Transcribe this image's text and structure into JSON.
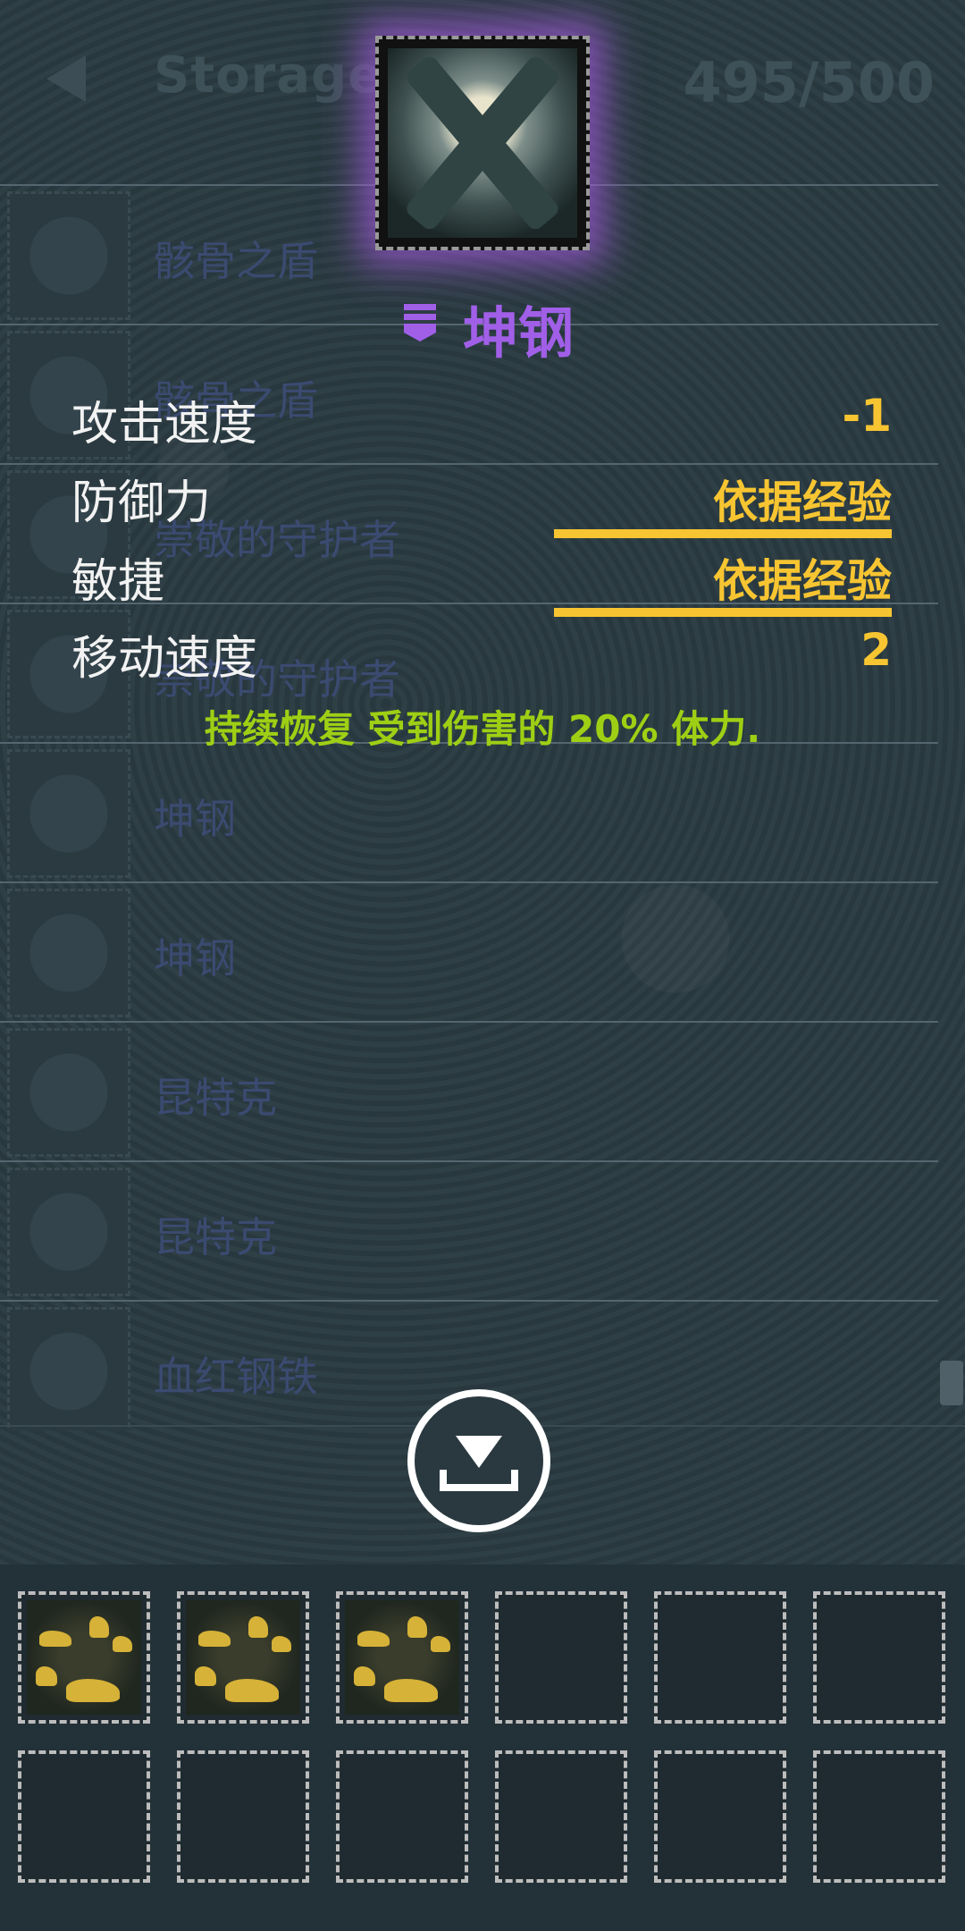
{
  "header": {
    "title": "Storage",
    "count": "495/500"
  },
  "storage_list": [
    {
      "name": "骸骨之盾"
    },
    {
      "name": "骸骨之盾"
    },
    {
      "name": "崇敬的守护者"
    },
    {
      "name": "崇敬的守护者"
    },
    {
      "name": "坤钢"
    },
    {
      "name": "坤钢"
    },
    {
      "name": "昆特克"
    },
    {
      "name": "昆特克"
    },
    {
      "name": "血红钢铁"
    }
  ],
  "tooltip": {
    "item_name": "坤钢",
    "rarity_color": "#a15fe8",
    "stats": [
      {
        "label": "攻击速度",
        "value": "-1"
      },
      {
        "label": "防御力",
        "value": "依据经验"
      },
      {
        "label": "敏捷",
        "value": "依据经验"
      },
      {
        "label": "移动速度",
        "value": "2"
      }
    ],
    "effect": "持续恢复 受到伤害的 20% 体力."
  },
  "inventory": {
    "slots": [
      {
        "filled": true,
        "icon": "gold-pile-icon"
      },
      {
        "filled": true,
        "icon": "gold-pile-icon"
      },
      {
        "filled": true,
        "icon": "gold-pile-icon"
      },
      {
        "filled": false
      },
      {
        "filled": false
      },
      {
        "filled": false
      },
      {
        "filled": false
      },
      {
        "filled": false
      },
      {
        "filled": false
      },
      {
        "filled": false
      },
      {
        "filled": false
      },
      {
        "filled": false
      }
    ]
  },
  "colors": {
    "value": "#f7c531",
    "effect": "#9fcf14",
    "rarity": "#a15fe8"
  }
}
